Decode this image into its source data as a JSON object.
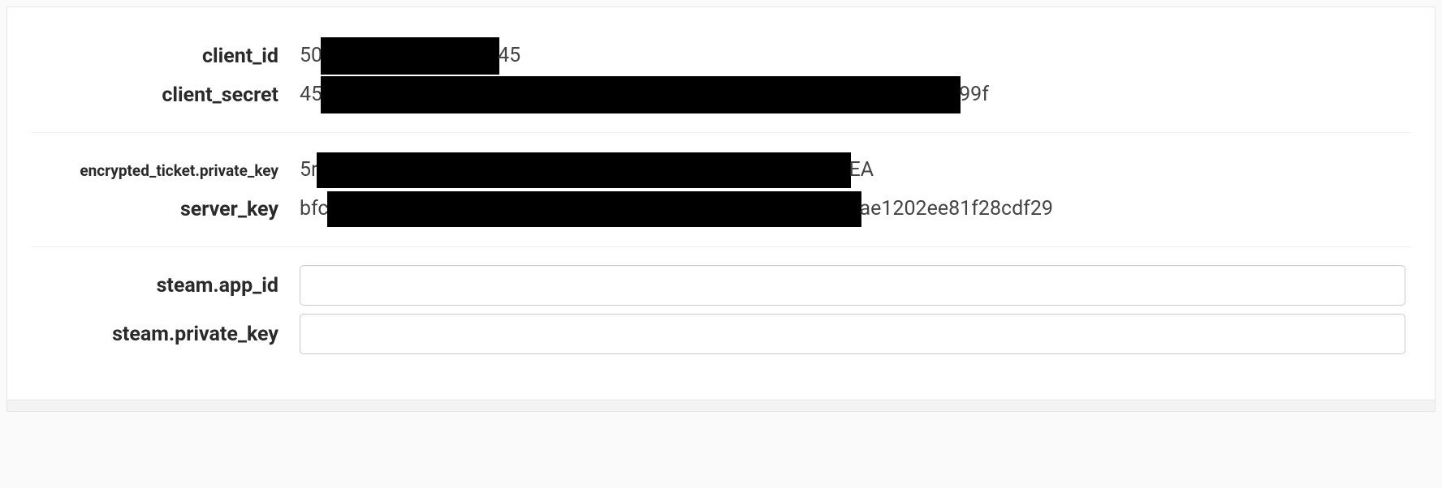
{
  "group1": {
    "client_id": {
      "label": "client_id",
      "value_prefix": "50",
      "value_suffix": "45"
    },
    "client_secret": {
      "label": "client_secret",
      "value_prefix": "45",
      "value_suffix": "99f"
    }
  },
  "group2": {
    "encrypted_ticket_private_key": {
      "label": "encrypted_ticket.private_key",
      "value_prefix": "5r",
      "value_suffix": "EA"
    },
    "server_key": {
      "label": "server_key",
      "value_prefix": "bfc",
      "value_suffix": "ae1202ee81f28cdf29"
    }
  },
  "group3": {
    "steam_app_id": {
      "label": "steam.app_id",
      "value": ""
    },
    "steam_private_key": {
      "label": "steam.private_key",
      "value": ""
    }
  }
}
